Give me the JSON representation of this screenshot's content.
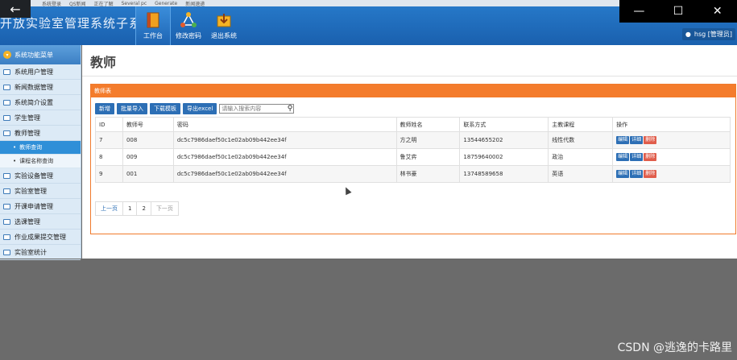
{
  "browser": {
    "tabs": [
      "系统登录",
      "QS新闻",
      "正在了解",
      "Several pc",
      "Generate",
      "新闻速递"
    ],
    "back_glyph": "←",
    "controls": [
      "—",
      "☐",
      "✕"
    ]
  },
  "app": {
    "title": "开放实验室管理系统子系统",
    "nav": [
      {
        "label": "工作台",
        "icon": "book-icon",
        "active": true
      },
      {
        "label": "修改密码",
        "icon": "network-icon",
        "active": false
      },
      {
        "label": "退出系统",
        "icon": "download-box-icon",
        "active": false
      }
    ],
    "user": "hsg [管理员]"
  },
  "sidebar": {
    "header": "系统功能菜单",
    "items": [
      {
        "label": "系统用户管理"
      },
      {
        "label": "新闻数据管理"
      },
      {
        "label": "系统简介设置"
      },
      {
        "label": "学生管理"
      },
      {
        "label": "教师管理"
      },
      {
        "label": "实验设备管理"
      },
      {
        "label": "实验室管理"
      },
      {
        "label": "开课申请管理"
      },
      {
        "label": "选课管理"
      },
      {
        "label": "作业成果提交管理"
      },
      {
        "label": "实验室统计"
      }
    ],
    "sub_items": [
      {
        "label": "教师查询",
        "active": true
      },
      {
        "label": "课程名称查询",
        "active": false
      }
    ]
  },
  "main": {
    "page_title": "教师",
    "panel_title": "教师表",
    "toolbar": {
      "add": "新增",
      "batch_import": "批量导入",
      "download_template": "下载模板",
      "export_excel": "导出excel",
      "search_placeholder": "请输入搜索内容"
    },
    "table": {
      "headers": [
        "ID",
        "教师号",
        "密码",
        "教师姓名",
        "联系方式",
        "主教课程",
        "操作"
      ],
      "rows": [
        [
          "7",
          "008",
          "dc5c7986daef50c1e02ab09b442ee34f",
          "方之明",
          "13544655202",
          "线性代数"
        ],
        [
          "8",
          "009",
          "dc5c7986daef50c1e02ab09b442ee34f",
          "鲁艾弈",
          "18759640002",
          "政治"
        ],
        [
          "9",
          "001",
          "dc5c7986daef50c1e02ab09b442ee34f",
          "林书豪",
          "13748589658",
          "英语"
        ]
      ],
      "actions": {
        "edit": "编辑",
        "detail": "详细",
        "delete": "删除"
      }
    },
    "pager": {
      "prev": "上一页",
      "pages": [
        "1",
        "2"
      ],
      "next": "下一页"
    }
  },
  "watermark": "CSDN @逃逸的卡路里"
}
